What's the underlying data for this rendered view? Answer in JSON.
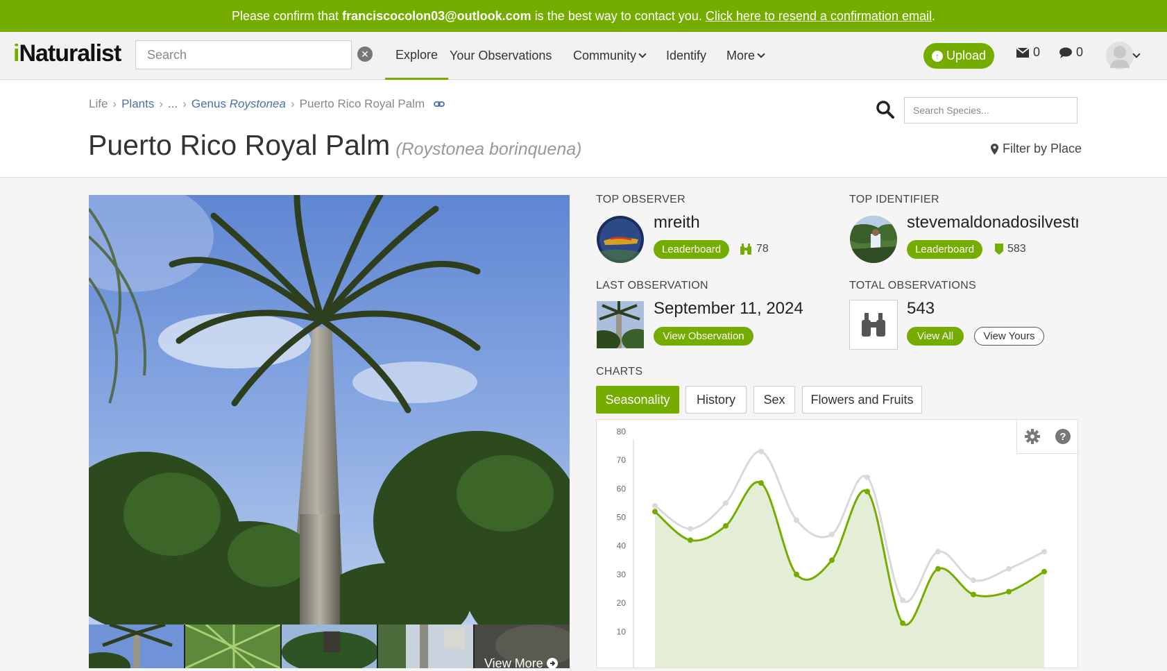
{
  "banner": {
    "prefix": "Please confirm that",
    "email": "franciscocolon03@outlook.com",
    "middle": "is the best way to contact you.",
    "link": "Click here to resend a confirmation email",
    "suffix": "."
  },
  "header": {
    "logo_i": "i",
    "logo_rest": "Naturalist",
    "search_placeholder": "Search",
    "nav": [
      "Explore",
      "Your Observations",
      "Community",
      "Identify",
      "More"
    ],
    "upload_label": "Upload",
    "messages_count": "0",
    "notifications_count": "0"
  },
  "taxon": {
    "breadcrumb": [
      "Life",
      "Plants",
      "...",
      "Genus",
      "Roystonea",
      "Puerto Rico Royal Palm"
    ],
    "common_name": "Puerto Rico Royal Palm",
    "scientific_name": "(Roystonea borinquena)",
    "species_search_placeholder": "Search Species...",
    "filter_by_place": "Filter by Place"
  },
  "photos": {
    "view_more": "View More"
  },
  "stats": {
    "top_observer": {
      "label": "TOP OBSERVER",
      "name": "mreith",
      "button": "Leaderboard",
      "count": "78"
    },
    "top_identifier": {
      "label": "TOP IDENTIFIER",
      "name": "stevemaldonadosilvestrir",
      "button": "Leaderboard",
      "count": "583"
    },
    "last_observation": {
      "label": "LAST OBSERVATION",
      "date": "September 11, 2024",
      "button": "View Observation"
    },
    "total_observations": {
      "label": "TOTAL OBSERVATIONS",
      "count": "543",
      "view_all": "View All",
      "view_yours": "View Yours"
    }
  },
  "charts": {
    "label": "CHARTS",
    "tabs": [
      "Seasonality",
      "History",
      "Sex",
      "Flowers and Fruits"
    ],
    "active_tab": "Seasonality"
  },
  "colors": {
    "accent": "#74ac00",
    "link": "#4a6fa8",
    "gray_series": "#d9d9d9",
    "fill": "#e4eed6"
  },
  "chart_data": {
    "type": "line",
    "ylim": [
      0,
      80
    ],
    "yticks": [
      10,
      20,
      30,
      40,
      50,
      60,
      70,
      80
    ],
    "series": [
      {
        "values": [
          54,
          46,
          55,
          73,
          49,
          44,
          64,
          21,
          38,
          28,
          32,
          38
        ]
      },
      {
        "values": [
          52,
          42,
          47,
          62,
          30,
          35,
          59,
          13,
          32,
          23,
          24,
          31
        ]
      }
    ]
  }
}
